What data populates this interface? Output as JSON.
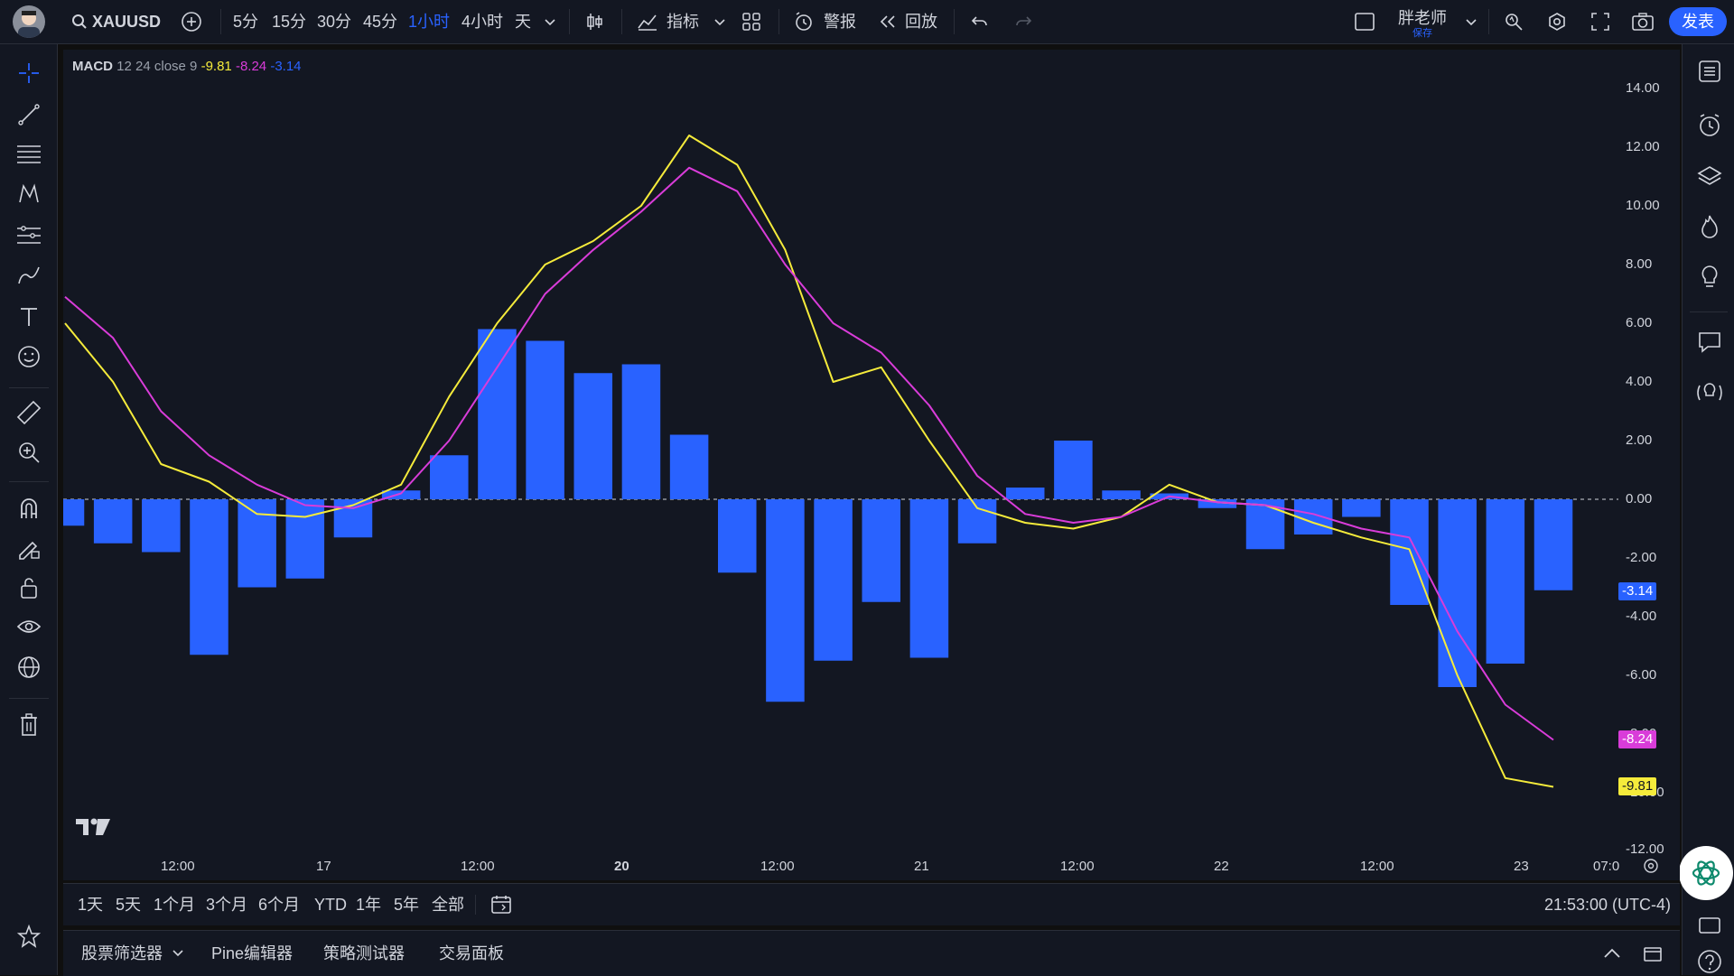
{
  "topbar": {
    "symbol": "XAUUSD",
    "intervals": [
      "5分",
      "15分",
      "30分",
      "45分",
      "1小时",
      "4小时",
      "天"
    ],
    "active_interval": "1小时",
    "indicators_label": "指标",
    "alert_label": "警报",
    "replay_label": "回放",
    "user_name": "胖老师",
    "save_label": "保存",
    "publish_label": "发表"
  },
  "legend": {
    "name": "MACD",
    "params": "12 24 close 9",
    "macd_value": "-9.81",
    "signal_value": "-8.24",
    "hist_value": "-3.14"
  },
  "price_axis": [
    "14.00",
    "12.00",
    "10.00",
    "8.00",
    "6.00",
    "4.00",
    "2.00",
    "0.00",
    "-2.00",
    "-4.00",
    "-6.00",
    "-8.00",
    "-10.00",
    "-12.00"
  ],
  "time_axis": [
    "12:00",
    "17",
    "12:00",
    "20",
    "12:00",
    "21",
    "12:00",
    "22",
    "12:00",
    "23",
    "07:0"
  ],
  "badges": {
    "hist": "-3.14",
    "signal": "-8.24",
    "macd": "-9.81"
  },
  "range_buttons": [
    "1天",
    "5天",
    "1个月",
    "3个月",
    "6个月",
    "YTD",
    "1年",
    "5年",
    "全部"
  ],
  "clock": "21:53:00 (UTC-4)",
  "panel_tabs": [
    "股票筛选器",
    "Pine编辑器",
    "策略测试器",
    "交易面板"
  ],
  "colors": {
    "macd": "#f5eb3b",
    "signal": "#d93cd9",
    "hist": "#2962ff",
    "bg": "#131722",
    "accent": "#2962ff"
  },
  "chart_data": {
    "type": "line",
    "title": "MACD 12 24 close 9",
    "ylim": [
      -12,
      14
    ],
    "series": [
      {
        "name": "MACD",
        "values": [
          6.0,
          4.0,
          1.2,
          0.6,
          -0.5,
          -0.6,
          -0.2,
          0.5,
          3.5,
          6.0,
          8.0,
          8.8,
          10.0,
          12.4,
          11.4,
          8.5,
          4.0,
          4.5,
          2.0,
          -0.3,
          -0.8,
          -1.0,
          -0.6,
          0.5,
          -0.1,
          -0.2,
          -0.8,
          -1.3,
          -1.7,
          -6.0,
          -9.5,
          -9.8
        ]
      },
      {
        "name": "Signal",
        "values": [
          6.9,
          5.5,
          3.0,
          1.5,
          0.5,
          -0.2,
          -0.3,
          0.2,
          2.0,
          4.5,
          7.0,
          8.5,
          9.8,
          11.3,
          10.5,
          8.0,
          6.0,
          5.0,
          3.2,
          0.8,
          -0.5,
          -0.8,
          -0.6,
          0.1,
          -0.1,
          -0.2,
          -0.5,
          -1.0,
          -1.3,
          -4.5,
          -7.0,
          -8.2
        ]
      },
      {
        "name": "Histogram",
        "values": [
          -0.9,
          -1.5,
          -1.8,
          -5.3,
          -3.0,
          -2.7,
          -1.3,
          0.3,
          1.5,
          5.8,
          5.4,
          4.3,
          4.6,
          2.2,
          -2.5,
          -6.9,
          -5.5,
          -3.5,
          -5.4,
          -1.5,
          0.4,
          2.0,
          0.3,
          0.2,
          -0.3,
          -1.7,
          -1.2,
          -0.6,
          -3.6,
          -6.4,
          -5.6,
          -3.1
        ]
      }
    ]
  }
}
